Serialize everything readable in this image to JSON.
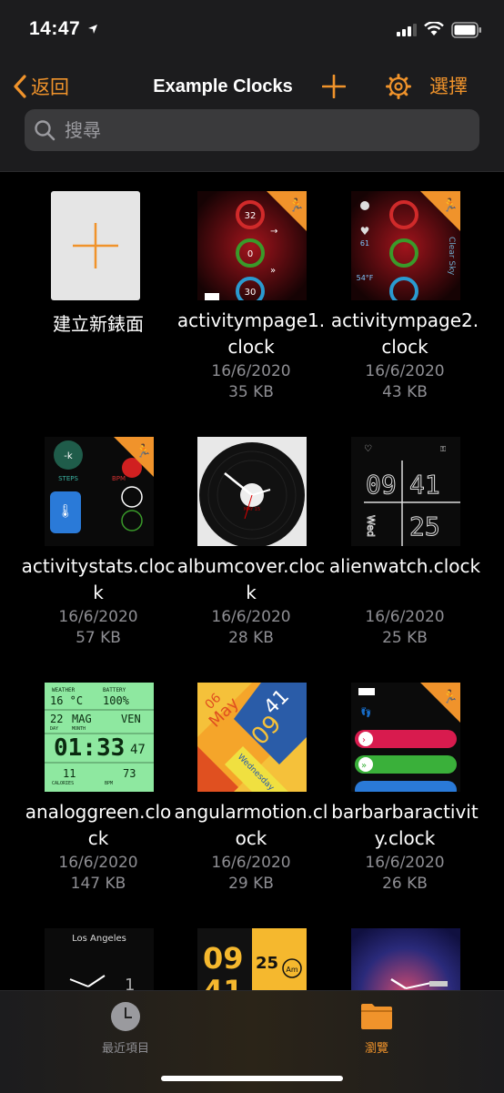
{
  "status": {
    "time": "14:47"
  },
  "nav": {
    "back_label": "返回",
    "title": "Example Clocks",
    "select_label": "選擇"
  },
  "search": {
    "placeholder": "搜尋"
  },
  "new_face": {
    "label": "建立新錶面"
  },
  "files": [
    {
      "name": "activitympage1.clock",
      "date": "16/6/2020",
      "size": "35 KB"
    },
    {
      "name": "activitympage2.clock",
      "date": "16/6/2020",
      "size": "43 KB"
    },
    {
      "name": "activitystats.clock",
      "date": "16/6/2020",
      "size": "57 KB"
    },
    {
      "name": "albumcover.clock",
      "date": "16/6/2020",
      "size": "28 KB"
    },
    {
      "name": "alienwatch.clock",
      "date": "16/6/2020",
      "size": "25 KB"
    },
    {
      "name": "analoggreen.clock",
      "date": "16/6/2020",
      "size": "147 KB"
    },
    {
      "name": "angularmotion.clock",
      "date": "16/6/2020",
      "size": "29 KB"
    },
    {
      "name": "barbarbaractivity.clock",
      "date": "16/6/2020",
      "size": "26 KB"
    }
  ],
  "thumb_text": {
    "ring1": "32",
    "ring2": "0",
    "ring3": "30",
    "weather_temp": "61",
    "weather_f": "54°F",
    "clear_sky": "Clear Sky",
    "steps_k": "-k",
    "steps": "STEPS",
    "bpm": "BPM",
    "album_date": "MAY 15",
    "alien_hour": "09",
    "alien_min": "41",
    "alien_wed": "Wed",
    "alien_day": "25",
    "green_weather": "WEATHER",
    "green_battery": "BATTERY",
    "green_temp": "16 °C",
    "green_batt": "100%",
    "green_day": "22",
    "green_month": "MAG",
    "green_wd": "VEN",
    "green_day_lbl": "DAY",
    "green_month_lbl": "MONTH",
    "green_time": "01:33",
    "green_sec": "47",
    "green_cal": "11",
    "green_bpm": "73",
    "green_cal_lbl": "CALORIES",
    "green_bpm_lbl": "BPM",
    "ang_day": "06",
    "ang_month": "May",
    "ang_min": "41",
    "ang_hour": "09",
    "ang_wd": "Wednesday",
    "la": "Los Angeles",
    "dig_h": "09",
    "dig_m": "41",
    "dig_25": "25",
    "am": "Am"
  },
  "tabs": {
    "recent_label": "最近項目",
    "browse_label": "瀏覽"
  },
  "colors": {
    "accent": "#f0932b"
  }
}
